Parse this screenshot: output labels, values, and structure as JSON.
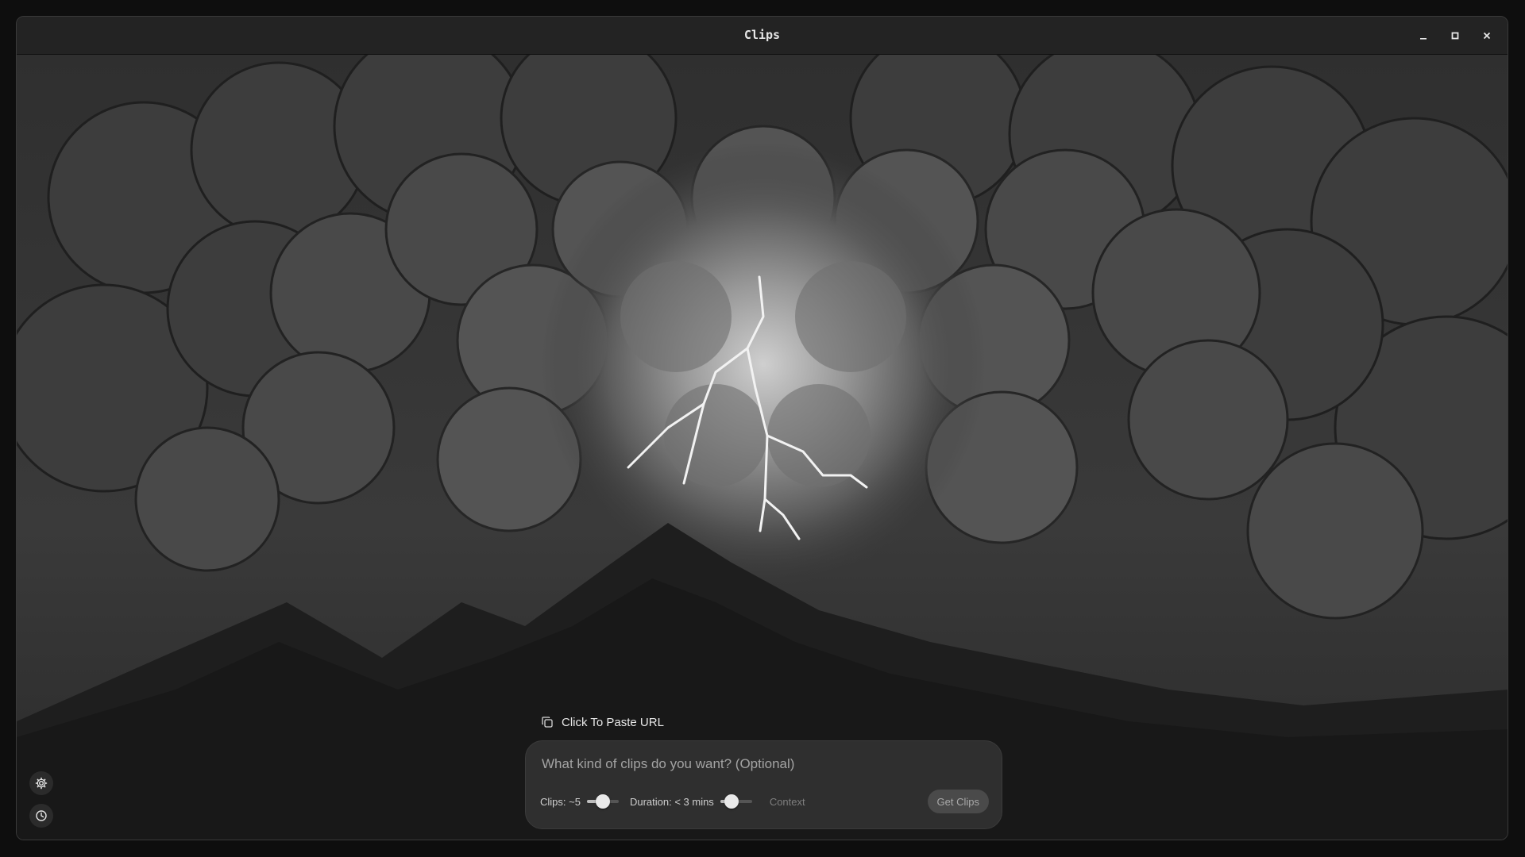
{
  "window": {
    "title": "Clips",
    "controls": [
      "minimize-icon",
      "maximize-icon",
      "close-icon"
    ]
  },
  "sidebar": {
    "icons": [
      "gear-icon",
      "clock-icon"
    ]
  },
  "paste": {
    "icon": "copy-icon",
    "label": "Click To Paste URL"
  },
  "prompt": {
    "placeholder": "What kind of clips do you want? (Optional)",
    "value": ""
  },
  "clips_slider": {
    "label": "Clips: ~5",
    "value_fraction": 0.5
  },
  "duration_slider": {
    "label": "Duration: < 3 mins",
    "value_fraction": 0.35
  },
  "context": {
    "label": "Context"
  },
  "submit": {
    "label": "Get Clips"
  },
  "colors": {
    "panel": "#2f2f2f",
    "button": "#4a4a4a",
    "accent": "#e9e9e9"
  }
}
